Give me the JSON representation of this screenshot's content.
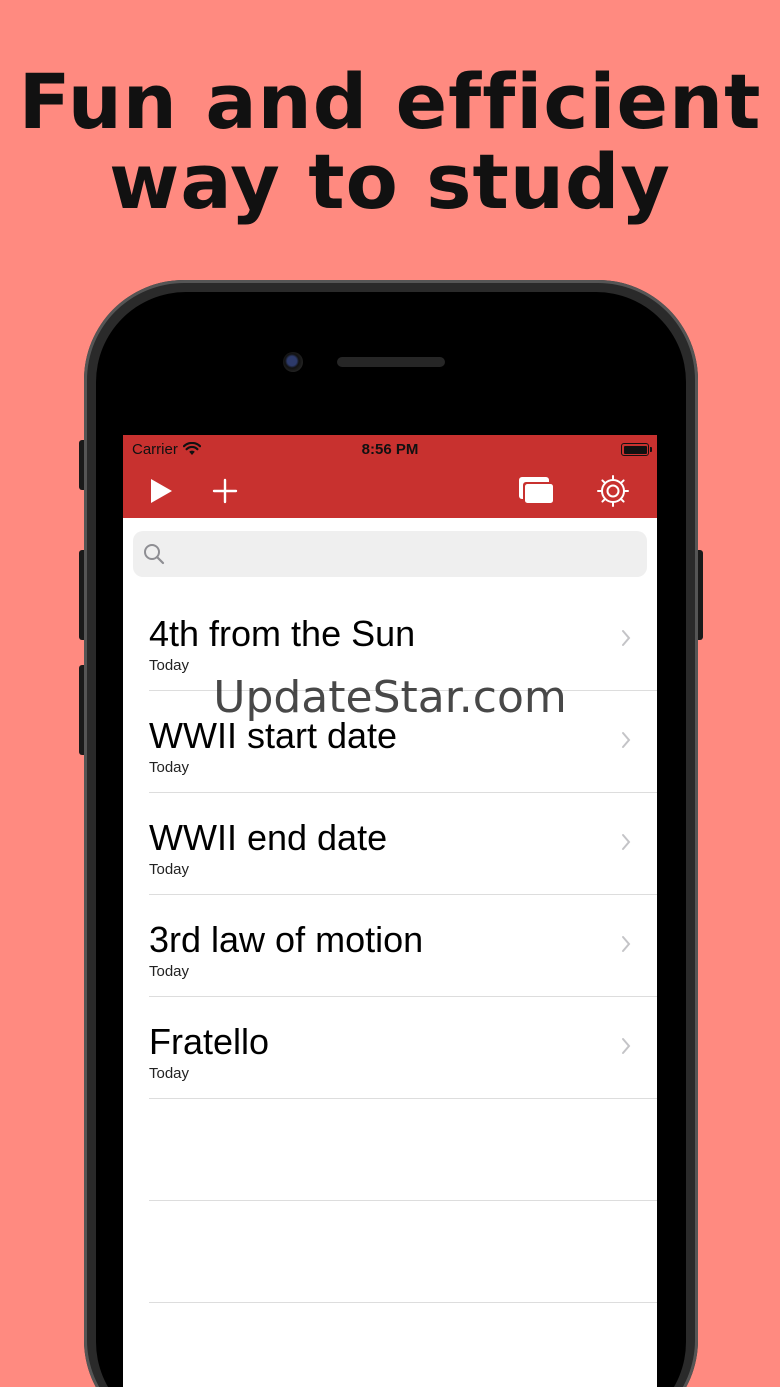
{
  "headline": {
    "line1": "Fun and efficient",
    "line2": "way to study"
  },
  "status_bar": {
    "carrier": "Carrier",
    "time": "8:56 PM"
  },
  "toolbar": {
    "play_icon": "play-icon",
    "add_icon": "plus-icon",
    "cards_icon": "cards-icon",
    "settings_icon": "gear-icon"
  },
  "search": {
    "placeholder": "",
    "value": ""
  },
  "list": {
    "items": [
      {
        "title": "4th from the Sun",
        "subtitle": "Today"
      },
      {
        "title": "WWII start date",
        "subtitle": "Today"
      },
      {
        "title": "WWII end date",
        "subtitle": "Today"
      },
      {
        "title": "3rd law of motion",
        "subtitle": "Today"
      },
      {
        "title": "Fratello",
        "subtitle": "Today"
      }
    ]
  },
  "watermark": "UpdateStar.com",
  "colors": {
    "background": "#FF8A80",
    "accent": "#C8312F"
  }
}
